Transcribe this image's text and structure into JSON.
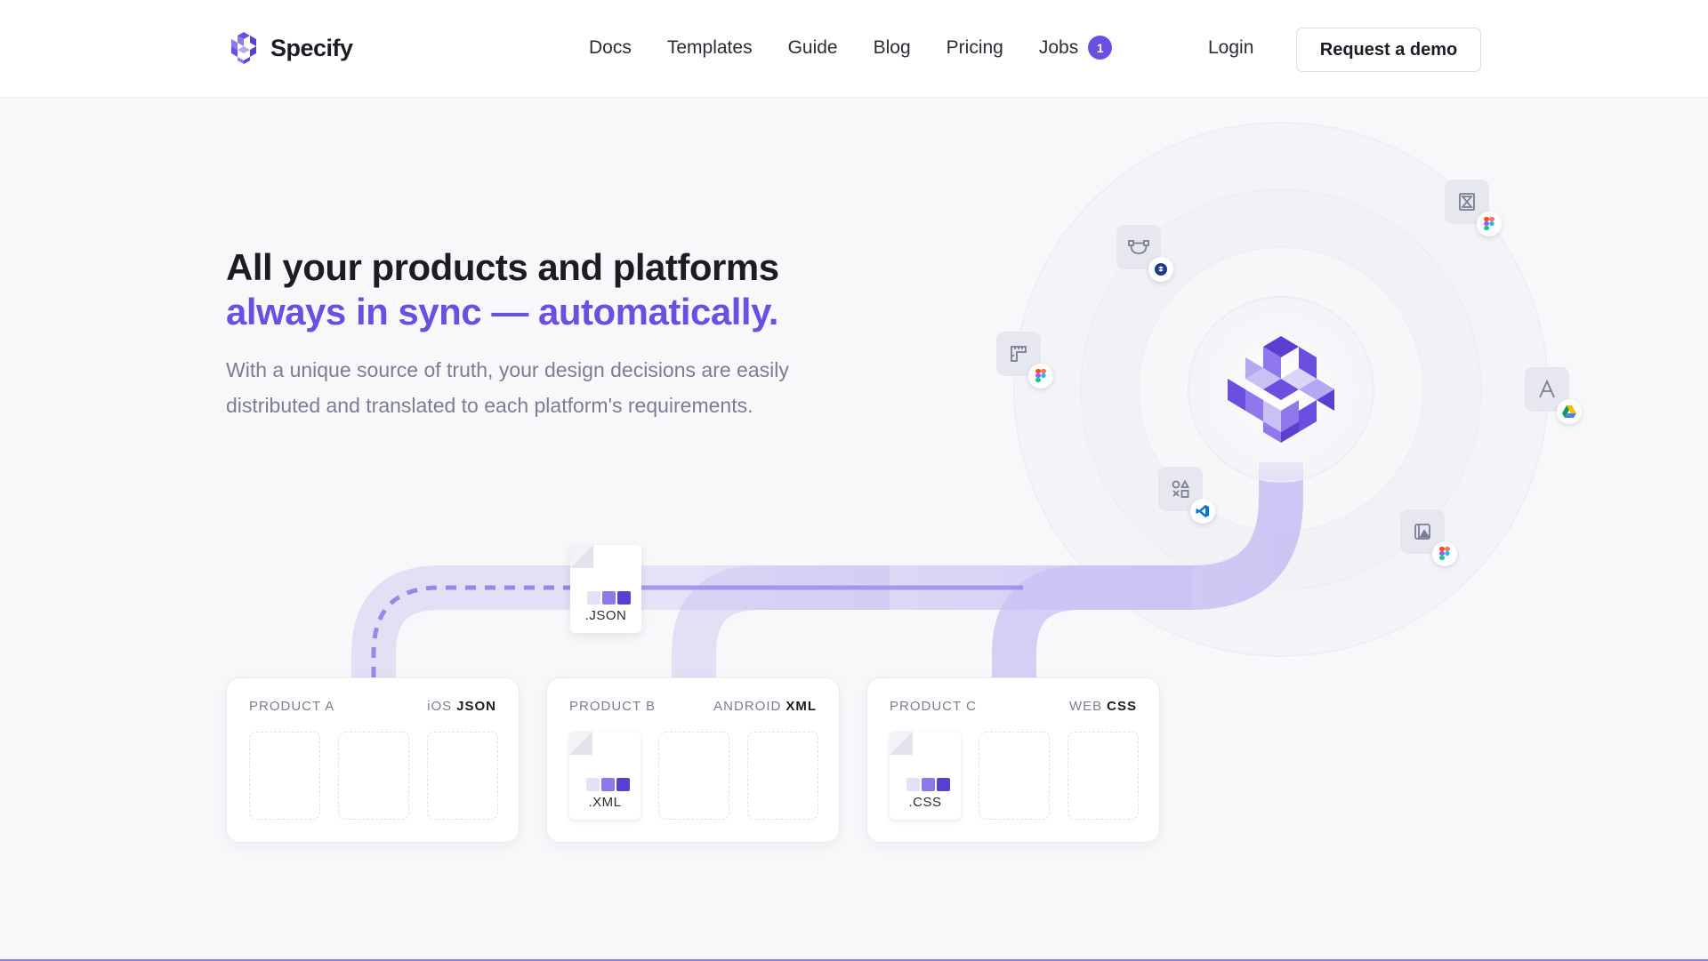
{
  "brand": {
    "name": "Specify"
  },
  "nav": {
    "items": [
      {
        "label": "Docs"
      },
      {
        "label": "Templates"
      },
      {
        "label": "Guide"
      },
      {
        "label": "Blog"
      },
      {
        "label": "Pricing"
      },
      {
        "label": "Jobs",
        "badge": "1"
      }
    ],
    "login_label": "Login",
    "demo_label": "Request a demo"
  },
  "hero": {
    "title_line1": "All your products and platforms",
    "title_line2": "always in sync — automatically.",
    "subtitle": "With a unique source of truth, your design decisions are easily distributed and translated to each platform's requirements."
  },
  "files": {
    "json": ".JSON",
    "xml": ".XML",
    "css": ".CSS"
  },
  "products": [
    {
      "name": "PRODUCT A",
      "platform": "iOS",
      "format": "JSON"
    },
    {
      "name": "PRODUCT B",
      "platform": "ANDROID",
      "format": "XML"
    },
    {
      "name": "PRODUCT C",
      "platform": "WEB",
      "format": "CSS"
    }
  ],
  "tools": [
    {
      "icon": "vector-path-icon",
      "source": "dropbox-icon"
    },
    {
      "icon": "hourglass-icon",
      "source": "figma-icon"
    },
    {
      "icon": "spacing-ruler-icon",
      "source": "figma-icon"
    },
    {
      "icon": "font-a-icon",
      "source": "google-drive-icon"
    },
    {
      "icon": "shapes-icon",
      "source": "vscode-icon"
    },
    {
      "icon": "image-asset-icon",
      "source": "figma-icon"
    }
  ],
  "colors": {
    "accent": "#6b4fe0",
    "accent_light": "#c9c0f3",
    "text": "#1c1d24",
    "muted": "#7a7e93"
  }
}
